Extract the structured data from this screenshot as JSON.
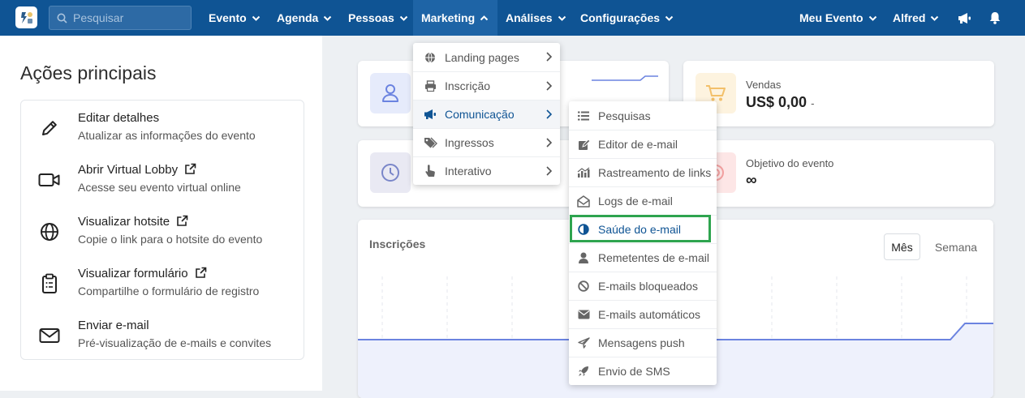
{
  "topbar": {
    "search_placeholder": "Pesquisar",
    "nav": [
      {
        "label": "Evento"
      },
      {
        "label": "Agenda"
      },
      {
        "label": "Pessoas"
      },
      {
        "label": "Marketing"
      },
      {
        "label": "Análises"
      },
      {
        "label": "Configurações"
      }
    ],
    "right": [
      {
        "label": "Meu Evento"
      },
      {
        "label": "Alfred"
      }
    ],
    "icons": [
      "megaphone-icon",
      "bell-icon"
    ]
  },
  "left_panel": {
    "title": "Ações principais",
    "actions": [
      {
        "title": "Editar detalhes",
        "subtitle": "Atualizar as informações do evento",
        "icon": "pencil-icon"
      },
      {
        "title": "Abrir Virtual Lobby",
        "subtitle": "Acesse seu evento virtual online",
        "icon": "video-camera-icon"
      },
      {
        "title": "Visualizar hotsite",
        "subtitle": "Copie o link para o hotsite do evento",
        "icon": "globe-icon"
      },
      {
        "title": "Visualizar formulário",
        "subtitle": "Compartilhe o formulário de registro",
        "icon": "clipboard-icon"
      },
      {
        "title": "Enviar e-mail",
        "subtitle": "Pré-visualização de e-mails e convites",
        "icon": "envelope-icon"
      }
    ]
  },
  "cards": {
    "sales": {
      "label": "Vendas",
      "value": "US$ 0,00",
      "delta": "-"
    },
    "goal": {
      "label": "Objetivo do evento",
      "value": "∞"
    },
    "registrations": {
      "title": "Inscrições",
      "tabs": [
        "Mês",
        "Semana"
      ],
      "active_tab": "Mês"
    }
  },
  "marketing_menu": {
    "items": [
      {
        "label": "Landing pages",
        "icon": "globe-icon"
      },
      {
        "label": "Inscrição",
        "icon": "printer-icon"
      },
      {
        "label": "Comunicação",
        "icon": "megaphone-icon",
        "active": true
      },
      {
        "label": "Ingressos",
        "icon": "tags-icon"
      },
      {
        "label": "Interativo",
        "icon": "hand-pointer-icon"
      }
    ]
  },
  "communication_menu": {
    "items": [
      {
        "label": "Pesquisas",
        "icon": "list-icon"
      },
      {
        "label": "Editor de e-mail",
        "icon": "edit-icon"
      },
      {
        "label": "Rastreamento de links",
        "icon": "bar-chart-icon"
      },
      {
        "label": "Logs de e-mail",
        "icon": "envelope-open-icon"
      },
      {
        "label": "Saúde do e-mail",
        "icon": "half-circle-icon",
        "highlighted": true
      },
      {
        "label": "Remetentes de e-mail",
        "icon": "user-icon"
      },
      {
        "label": "E-mails bloqueados",
        "icon": "ban-icon"
      },
      {
        "label": "E-mails automáticos",
        "icon": "envelope-icon"
      },
      {
        "label": "Mensagens push",
        "icon": "paper-plane-icon"
      },
      {
        "label": "Envio de SMS",
        "icon": "rocket-icon"
      }
    ]
  },
  "colors": {
    "topbar": "#0f5494",
    "active_link": "#0f5494",
    "highlight_border": "#2ea44f",
    "chart_line": "#6b83e0"
  }
}
